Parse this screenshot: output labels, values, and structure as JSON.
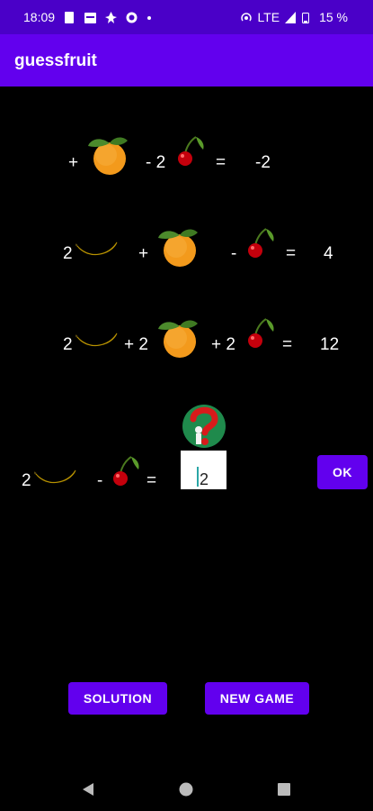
{
  "status": {
    "time": "18:09",
    "network": "LTE",
    "battery": "15 %"
  },
  "app": {
    "title": "guessfruit"
  },
  "equations": [
    {
      "t1": "+",
      "t2": "- 2",
      "eq": "=",
      "result": "-2"
    },
    {
      "c1": "2",
      "op2": "+",
      "op3": "-",
      "eq": "=",
      "result": "4"
    },
    {
      "c1": "2",
      "op2": "+ 2",
      "op3": "+ 2",
      "eq": "=",
      "result": "12"
    }
  ],
  "question": {
    "c1": "2",
    "op2": "-",
    "eq": "="
  },
  "answer": {
    "value": "2"
  },
  "buttons": {
    "ok": "OK",
    "solution": "SOLUTION",
    "new_game": "NEW GAME"
  },
  "colors": {
    "appbar": "#6200ee",
    "statusbar": "#4a00c8",
    "button": "#6200ee"
  }
}
